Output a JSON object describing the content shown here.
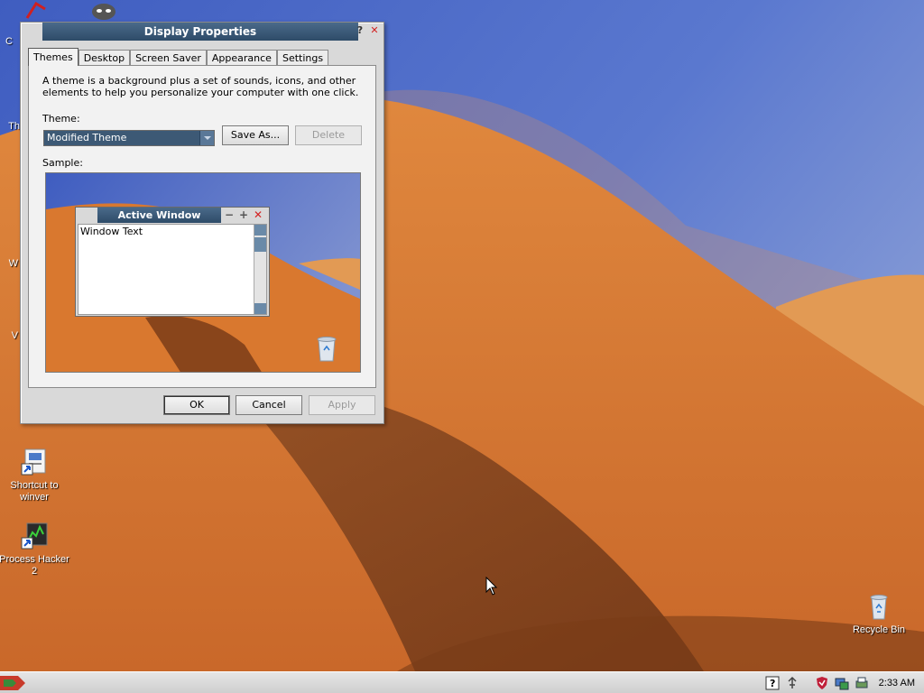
{
  "desktop": {
    "icons": [
      {
        "label": "Shortcut to\nwinver",
        "icon": "winver-shortcut-icon"
      },
      {
        "label": "Process Hacker\n2",
        "icon": "process-hacker-icon"
      },
      {
        "label": "Recycle Bin",
        "icon": "recycle-bin-icon"
      }
    ],
    "partial_labels": [
      "C",
      "Th",
      "W",
      "V"
    ]
  },
  "dialog": {
    "title": "Display Properties",
    "help_glyph": "?",
    "close_glyph": "✕",
    "tabs": [
      "Themes",
      "Desktop",
      "Screen Saver",
      "Appearance",
      "Settings"
    ],
    "active_tab": "Themes",
    "description": "A theme is a background plus a set of sounds, icons, and other elements to help you personalize your computer with one click.",
    "theme_label": "Theme:",
    "theme_value": "Modified Theme",
    "save_as_label": "Save As...",
    "delete_label": "Delete",
    "sample_label": "Sample:",
    "sample": {
      "window_title": "Active Window",
      "window_text": "Window Text",
      "min_glyph": "−",
      "max_glyph": "+",
      "close_glyph": "✕"
    },
    "ok_label": "OK",
    "cancel_label": "Cancel",
    "apply_label": "Apply"
  },
  "taskbar": {
    "clock": "2:33 AM",
    "tray_icons": [
      "help-icon",
      "network-icon",
      "security-shield-icon",
      "computer-icon",
      "printer-icon"
    ]
  },
  "colors": {
    "title_bar": "#2e4b68",
    "sky": "#4f6fca",
    "dune": "#d9762f"
  }
}
